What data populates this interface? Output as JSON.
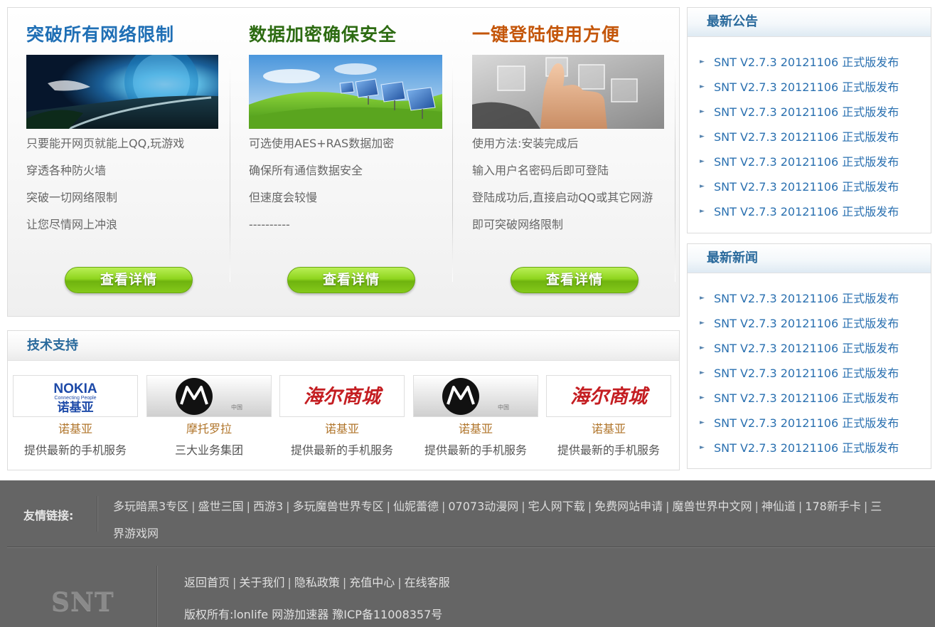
{
  "features": [
    {
      "title": "突破所有网络限制",
      "image_icon": "earth-globe-image",
      "lines": [
        "只要能开网页就能上QQ,玩游戏",
        "穿透各种防火墙",
        "突破一切网络限制",
        "让您尽情网上冲浪"
      ],
      "button_label": "查看详情"
    },
    {
      "title": "数据加密确保安全",
      "image_icon": "solar-panel-field-image",
      "lines": [
        "可选使用AES+RAS数据加密",
        "确保所有通信数据安全",
        "但速度会较慢",
        "----------"
      ],
      "button_label": "查看详情"
    },
    {
      "title": "一键登陆使用方便",
      "image_icon": "touch-screen-hand-image",
      "lines": [
        "使用方法:安装完成后",
        "输入用户名密码后即可登陆",
        "登陆成功后,直接启动QQ或其它网游",
        "即可突破网络限制"
      ],
      "button_label": "查看详情"
    }
  ],
  "announcements": {
    "title": "最新公告",
    "items": [
      "SNT V2.7.3 20121106 正式版发布",
      "SNT V2.7.3 20121106 正式版发布",
      "SNT V2.7.3 20121106 正式版发布",
      "SNT V2.7.3 20121106 正式版发布",
      "SNT V2.7.3 20121106 正式版发布",
      "SNT V2.7.3 20121106 正式版发布",
      "SNT V2.7.3 20121106 正式版发布"
    ]
  },
  "news": {
    "title": "最新新闻",
    "items": [
      "SNT V2.7.3 20121106 正式版发布",
      "SNT V2.7.3 20121106 正式版发布",
      "SNT V2.7.3 20121106 正式版发布",
      "SNT V2.7.3 20121106 正式版发布",
      "SNT V2.7.3 20121106 正式版发布",
      "SNT V2.7.3 20121106 正式版发布",
      "SNT V2.7.3 20121106 正式版发布"
    ]
  },
  "tech_support": {
    "title": "技术支持",
    "partners": [
      {
        "logo": "nokia",
        "logo_text": "NOKIA",
        "logo_sub": "Connecting People",
        "logo_cn": "诺基亚",
        "name": "诺基亚",
        "desc": "提供最新的手机服务"
      },
      {
        "logo": "motorola",
        "logo_tag": "中国",
        "name": "摩托罗拉",
        "desc": "三大业务集团"
      },
      {
        "logo": "haier-mall",
        "logo_text": "海尔商城",
        "name": "诺基亚",
        "desc": "提供最新的手机服务"
      },
      {
        "logo": "motorola",
        "logo_tag": "中国",
        "name": "诺基亚",
        "desc": "提供最新的手机服务"
      },
      {
        "logo": "haier-mall",
        "logo_text": "海尔商城",
        "name": "诺基亚",
        "desc": "提供最新的手机服务"
      }
    ]
  },
  "footer": {
    "friend_label": "友情链接:",
    "friend_links": [
      "多玩暗黑3专区",
      "盛世三国",
      "西游3",
      "多玩魔兽世界专区",
      "仙妮蕾德",
      "07073动漫网",
      "宅人网下载",
      "免费网站申请",
      "魔兽世界中文网",
      "神仙道",
      "178新手卡",
      "三界游戏网"
    ],
    "logo_text": "SNT",
    "nav_links": [
      "返回首页",
      "关于我们",
      "隐私政策",
      "充值中心",
      "在线客服"
    ],
    "copyright": "版权所有:lonlife 网游加速器 豫ICP备11008357号"
  },
  "colors": {
    "accent_blue": "#2a6a9c",
    "link_blue": "#2a70b0",
    "title_blue": "#1f6fb5",
    "title_green": "#2d6b12",
    "title_orange": "#c4560a",
    "button_green": "#8fd51e",
    "partner_name": "#b0752b",
    "footer_bg": "#656565"
  }
}
